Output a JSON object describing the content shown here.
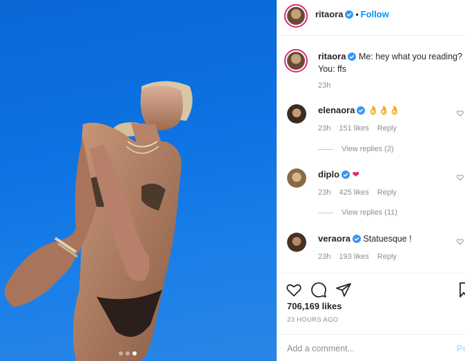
{
  "post": {
    "image_alt_icon": "photo",
    "carousel_dots": 3,
    "carousel_active": 2
  },
  "header": {
    "username": "ritaora",
    "separator": "•",
    "follow_label": "Follow"
  },
  "caption": {
    "username": "ritaora",
    "text": "Me: hey what you reading? You: ffs",
    "time": "23h"
  },
  "comments": [
    {
      "username": "elenaora",
      "text": "👌👌👌",
      "time": "23h",
      "likes": "151 likes",
      "reply": "Reply",
      "view_replies": "View replies (2)"
    },
    {
      "username": "diplo",
      "text": "❤",
      "time": "23h",
      "likes": "425 likes",
      "reply": "Reply",
      "view_replies": "View replies (11)"
    },
    {
      "username": "veraora",
      "text": "Statuesque !",
      "time": "23h",
      "likes": "193 likes",
      "reply": "Reply"
    }
  ],
  "actions": {
    "likes_count": "706,169 likes",
    "time_ago": "23 HOURS AGO"
  },
  "add_comment": {
    "placeholder": "Add a comment...",
    "post_label": "Post"
  },
  "colors": {
    "accent": "#0095f6",
    "verified": "#3897f0",
    "muted": "#8e8e8e",
    "sky": "#0d72e3"
  }
}
